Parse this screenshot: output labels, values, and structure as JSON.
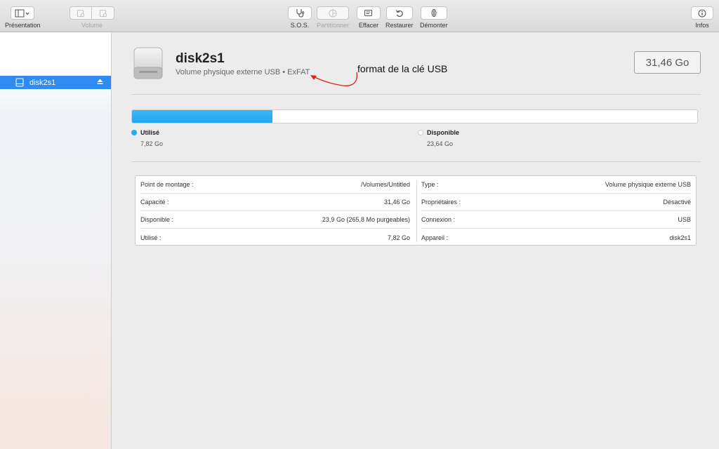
{
  "toolbar": {
    "presentation_label": "Présentation",
    "volume_label": "Volume",
    "sos_label": "S.O.S.",
    "partition_label": "Partitionner",
    "erase_label": "Effacer",
    "restore_label": "Restaurer",
    "unmount_label": "Démonter",
    "info_label": "Infos"
  },
  "sidebar": {
    "items": [
      {
        "label": "disk2s1",
        "selected": true
      }
    ]
  },
  "volume": {
    "name": "disk2s1",
    "description": "Volume physique externe USB • ExFAT",
    "size": "31,46 Go",
    "annotation": "format de la clé USB"
  },
  "usage": {
    "used_fraction": 0.249,
    "used_label": "Utilisé",
    "used_value": "7,82 Go",
    "free_label": "Disponible",
    "free_value": "23,64 Go",
    "used_color": "#2aa9f0",
    "free_color": "#ffffff"
  },
  "info": {
    "left": [
      {
        "key": "Point de montage :",
        "value": "/Volumes/Untitled"
      },
      {
        "key": "Capacité :",
        "value": "31,46 Go"
      },
      {
        "key": "Disponible :",
        "value": "23,9 Go (265,8 Mo purgeables)"
      },
      {
        "key": "Utilisé :",
        "value": "7,82 Go"
      }
    ],
    "right": [
      {
        "key": "Type :",
        "value": "Volume physique externe USB"
      },
      {
        "key": "Propriétaires :",
        "value": "Désactivé"
      },
      {
        "key": "Connexion :",
        "value": "USB"
      },
      {
        "key": "Appareil :",
        "value": "disk2s1"
      }
    ]
  },
  "colors": {
    "accent": "#2f8bf0",
    "annotation_arrow": "#d9251c"
  }
}
